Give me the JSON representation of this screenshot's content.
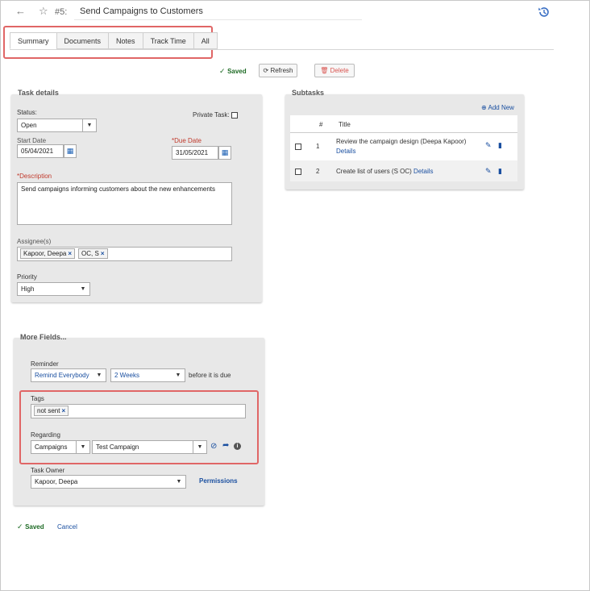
{
  "header": {
    "task_number": "#5:",
    "task_title": "Send Campaigns to Customers"
  },
  "tabs": [
    {
      "label": "Summary",
      "active": true
    },
    {
      "label": "Documents",
      "active": false
    },
    {
      "label": "Notes",
      "active": false
    },
    {
      "label": "Track Time",
      "active": false
    },
    {
      "label": "All",
      "active": false
    }
  ],
  "toolbar": {
    "saved_label": "Saved",
    "refresh_label": "Refresh",
    "delete_label": "Delete"
  },
  "task_details": {
    "legend": "Task details",
    "status_label": "Status:",
    "status_value": "Open",
    "private_task_label": "Private Task:",
    "private_task_checked": false,
    "start_date_label": "Start Date",
    "start_date_value": "05/04/2021",
    "due_date_label": "*Due Date",
    "due_date_value": "31/05/2021",
    "description_label": "*Description",
    "description_value": "Send campaigns informing customers about the new enhancements",
    "assignees_label": "Assignee(s)",
    "assignees": [
      "Kapoor, Deepa",
      "OC, S"
    ],
    "priority_label": "Priority",
    "priority_value": "High"
  },
  "subtasks": {
    "legend": "Subtasks",
    "add_new_label": "Add New",
    "columns": [
      "#",
      "Title"
    ],
    "rows": [
      {
        "number": "1",
        "title": "Review the campaign design (Deepa Kapoor)",
        "details_label": "Details"
      },
      {
        "number": "2",
        "title": "Create list of users (S OC)",
        "details_label": "Details"
      }
    ]
  },
  "more_fields": {
    "legend": "More Fields...",
    "reminder_label": "Reminder",
    "reminder_who": "Remind Everybody",
    "reminder_when": "2 Weeks",
    "reminder_suffix": "before it is due",
    "tags_label": "Tags",
    "tags": [
      "not sent"
    ],
    "regarding_label": "Regarding",
    "regarding_type": "Campaigns",
    "regarding_value": "Test Campaign",
    "task_owner_label": "Task Owner",
    "task_owner_value": "Kapoor, Deepa",
    "permissions_label": "Permissions"
  },
  "footer": {
    "saved_label": "Saved",
    "cancel_label": "Cancel"
  },
  "colors": {
    "accent_blue": "#1a4fa0",
    "saved_green": "#1e6b25",
    "required_red": "#c0392b",
    "highlight_red": "#e06666"
  }
}
